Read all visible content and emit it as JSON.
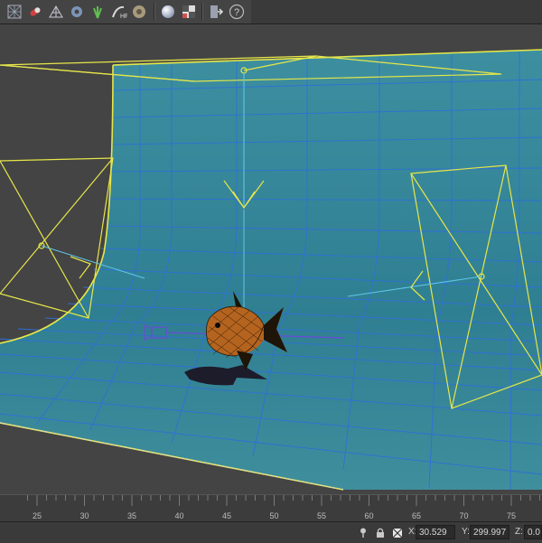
{
  "toolbar": {
    "icons": [
      "teapot-grid-icon",
      "spray-capsule-icon",
      "lattice-icon",
      "gear-cluster-icon",
      "plant-icon",
      "hair-fur-icon",
      "curl-icon",
      "sphere-icon",
      "checker-icon",
      "export-icon",
      "help-icon"
    ],
    "help_label": "?"
  },
  "colors": {
    "viewport_bg": "#444444",
    "backdrop_fill": "#3f8a9a",
    "grid_line": "#2f6fd6",
    "selection_yellow": "#e6e64a",
    "light_cyan": "#5fc6e8"
  },
  "timeline": {
    "ticks": [
      "25",
      "30",
      "35",
      "40",
      "45",
      "50",
      "55",
      "60",
      "65",
      "70",
      "75"
    ]
  },
  "status": {
    "x_label": "X:",
    "x_value": "30.529",
    "y_label": "Y:",
    "y_value": "299.997",
    "z_label": "Z:",
    "z_value": "0.0"
  }
}
